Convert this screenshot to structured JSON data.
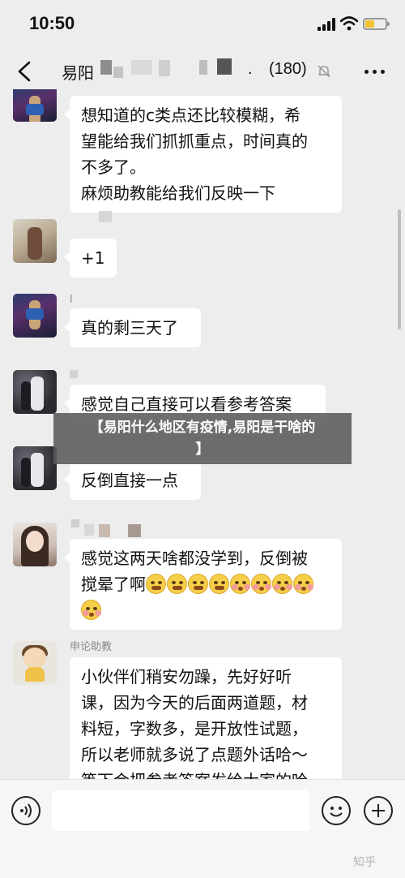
{
  "status_bar": {
    "time": "10:50"
  },
  "header": {
    "title": "易阳",
    "separator": ".",
    "member_count": "(180)"
  },
  "messages": [
    {
      "lines": [
        "想知道的c类点还比较模糊，希",
        "望能给我们抓抓重点，时间真的",
        "不多了。",
        "麻烦助教能给我们反映一下"
      ]
    },
    {
      "lines": [
        "+1"
      ]
    },
    {
      "sender": "l",
      "lines": [
        "真的剩三天了"
      ]
    },
    {
      "lines": [
        "感觉自己直接可以看参考答案"
      ]
    },
    {
      "lines": [
        "反倒直接一点"
      ]
    },
    {
      "lines": [
        "感觉这两天啥都没学到，反倒被",
        "搅晕了啊"
      ],
      "emojis_line2": [
        "cry",
        "cry",
        "cry",
        "cry",
        "blush",
        "blush",
        "blush",
        "blush"
      ],
      "emojis_line3": [
        "blush"
      ]
    },
    {
      "sender": "申论助教",
      "lines": [
        "小伙伴们稍安勿躁，先好好听",
        "课，因为今天的后面两道题，材",
        "料短，字数多，是开放性试题，",
        "所以老师就多说了点题外话哈～",
        "等下会把参考答案发给大家的哈"
      ]
    }
  ],
  "banner": {
    "line1": "【易阳什么地区有疫情,易阳是干啥的",
    "line2": "】"
  },
  "watermark": "知乎"
}
